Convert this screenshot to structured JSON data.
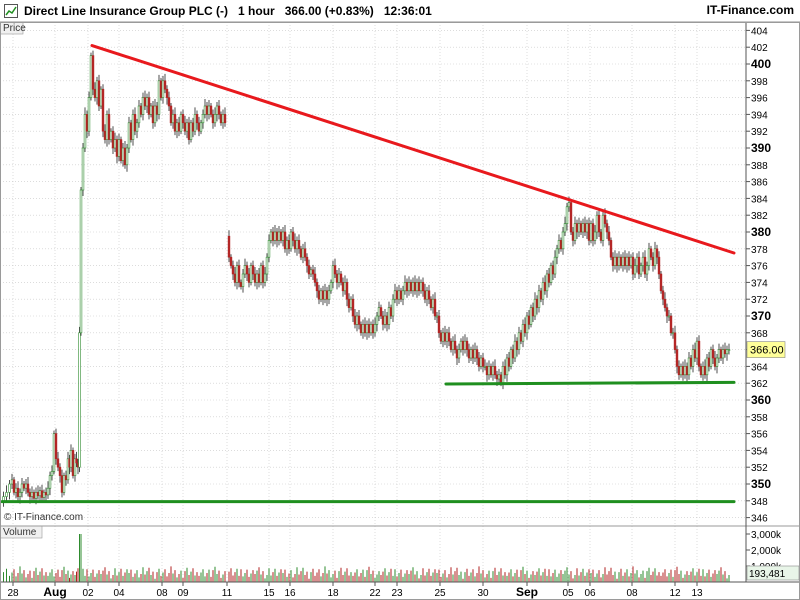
{
  "header": {
    "symbol": "Direct Line Insurance Group PLC (-)",
    "interval": "1 hour",
    "last": "366.00 (+0.83%)",
    "time": "12:36:01",
    "brand": "IT-Finance.com"
  },
  "panes": {
    "price_label": "Price",
    "volume_label": "Volume",
    "watermark": "© IT-Finance.com"
  },
  "colors": {
    "up": "#2e8b2e",
    "down": "#b22222",
    "resistance": "#e8191d",
    "support": "#1f8f1f",
    "grid": "#c8c8c8"
  },
  "chart_data": {
    "type": "candlestick",
    "title": "Direct Line Insurance Group PLC (-)",
    "interval": "1 hour",
    "y_ticks": [
      346,
      348,
      350,
      352,
      354,
      356,
      358,
      360,
      362,
      364,
      366,
      368,
      370,
      372,
      374,
      376,
      378,
      380,
      382,
      384,
      386,
      388,
      390,
      392,
      394,
      396,
      398,
      400,
      402,
      404
    ],
    "ylim": [
      345,
      405
    ],
    "last_price_label": "366.00",
    "x_ticks": [
      "28",
      "Aug",
      "02",
      "04",
      "08",
      "09",
      "11",
      "15",
      "16",
      "18",
      "22",
      "23",
      "25",
      "30",
      "Sep",
      "05",
      "06",
      "08",
      "12",
      "13"
    ],
    "price_path": [
      [
        0,
        348
      ],
      [
        3,
        348.5
      ],
      [
        6,
        349
      ],
      [
        9,
        350
      ],
      [
        11,
        350.5
      ],
      [
        13,
        349
      ],
      [
        15,
        349.5
      ],
      [
        17,
        348.5
      ],
      [
        19,
        349
      ],
      [
        21,
        350
      ],
      [
        23,
        349.5
      ],
      [
        25,
        350
      ],
      [
        27,
        349
      ],
      [
        29,
        348.5
      ],
      [
        31,
        349
      ],
      [
        33,
        348.3
      ],
      [
        35,
        349
      ],
      [
        37,
        348.6
      ],
      [
        39,
        349.2
      ],
      [
        41,
        348.4
      ],
      [
        43,
        349
      ],
      [
        45,
        348.7
      ],
      [
        47,
        349.5
      ],
      [
        49,
        351
      ],
      [
        51,
        351.5
      ],
      [
        53,
        356
      ],
      [
        55,
        353
      ],
      [
        57,
        352
      ],
      [
        59,
        351
      ],
      [
        61,
        349
      ],
      [
        63,
        351
      ],
      [
        65,
        350.5
      ],
      [
        67,
        353
      ],
      [
        68,
        352
      ],
      [
        70,
        354
      ],
      [
        72,
        351
      ],
      [
        74,
        353
      ],
      [
        75,
        352.5
      ],
      [
        77,
        352
      ],
      [
        78,
        368
      ],
      [
        80,
        385
      ],
      [
        82,
        390
      ],
      [
        84,
        394
      ],
      [
        86,
        392
      ],
      [
        88,
        396
      ],
      [
        90,
        401
      ],
      [
        92,
        397
      ],
      [
        94,
        396
      ],
      [
        96,
        398
      ],
      [
        98,
        395
      ],
      [
        100,
        397
      ],
      [
        102,
        392
      ],
      [
        104,
        391
      ],
      [
        106,
        394
      ],
      [
        108,
        391
      ],
      [
        110,
        392
      ],
      [
        112,
        390
      ],
      [
        114,
        391
      ],
      [
        116,
        389
      ],
      [
        118,
        391
      ],
      [
        120,
        388.5
      ],
      [
        122,
        390
      ],
      [
        124,
        388
      ],
      [
        126,
        390
      ],
      [
        128,
        393
      ],
      [
        130,
        391
      ],
      [
        132,
        394
      ],
      [
        134,
        392
      ],
      [
        136,
        393
      ],
      [
        138,
        395
      ],
      [
        140,
        394
      ],
      [
        142,
        396
      ],
      [
        144,
        395
      ],
      [
        146,
        396
      ],
      [
        148,
        394
      ],
      [
        150,
        395
      ],
      [
        152,
        393
      ],
      [
        154,
        395
      ],
      [
        156,
        394
      ],
      [
        158,
        398
      ],
      [
        160,
        396
      ],
      [
        162,
        398
      ],
      [
        164,
        397
      ],
      [
        166,
        396
      ],
      [
        168,
        395
      ],
      [
        170,
        393
      ],
      [
        172,
        394
      ],
      [
        174,
        392
      ],
      [
        176,
        393
      ],
      [
        178,
        392
      ],
      [
        180,
        394
      ],
      [
        182,
        393
      ],
      [
        184,
        392
      ],
      [
        186,
        393
      ],
      [
        188,
        391
      ],
      [
        190,
        393
      ],
      [
        192,
        392
      ],
      [
        194,
        394
      ],
      [
        196,
        393
      ],
      [
        198,
        392
      ],
      [
        200,
        393
      ],
      [
        202,
        394
      ],
      [
        204,
        395
      ],
      [
        206,
        394
      ],
      [
        208,
        395
      ],
      [
        210,
        394
      ],
      [
        212,
        393
      ],
      [
        214,
        394
      ],
      [
        216,
        395
      ],
      [
        218,
        394
      ],
      [
        220,
        393
      ],
      [
        222,
        394
      ],
      [
        224,
        393
      ],
      [
        226,
        379.5
      ],
      [
        228,
        377
      ],
      [
        230,
        376
      ],
      [
        232,
        375
      ],
      [
        234,
        374
      ],
      [
        236,
        376
      ],
      [
        238,
        374
      ],
      [
        240,
        373.5
      ],
      [
        242,
        375
      ],
      [
        244,
        376
      ],
      [
        246,
        375
      ],
      [
        248,
        374
      ],
      [
        250,
        376
      ],
      [
        252,
        375
      ],
      [
        254,
        374
      ],
      [
        256,
        375
      ],
      [
        258,
        374
      ],
      [
        260,
        376
      ],
      [
        262,
        374
      ],
      [
        264,
        375
      ],
      [
        266,
        377
      ],
      [
        268,
        379
      ],
      [
        270,
        380
      ],
      [
        272,
        379
      ],
      [
        274,
        380
      ],
      [
        276,
        379
      ],
      [
        278,
        380
      ],
      [
        280,
        379
      ],
      [
        282,
        380
      ],
      [
        284,
        378
      ],
      [
        286,
        379
      ],
      [
        288,
        378
      ],
      [
        290,
        380
      ],
      [
        292,
        379
      ],
      [
        294,
        378
      ],
      [
        296,
        379
      ],
      [
        298,
        378
      ],
      [
        300,
        377
      ],
      [
        302,
        378
      ],
      [
        304,
        377
      ],
      [
        306,
        376
      ],
      [
        308,
        375
      ],
      [
        310,
        375.5
      ],
      [
        312,
        375
      ],
      [
        314,
        374
      ],
      [
        316,
        373
      ],
      [
        318,
        372
      ],
      [
        320,
        373
      ],
      [
        322,
        372
      ],
      [
        324,
        373
      ],
      [
        326,
        372
      ],
      [
        328,
        373
      ],
      [
        330,
        374
      ],
      [
        332,
        376
      ],
      [
        334,
        375
      ],
      [
        336,
        374
      ],
      [
        338,
        375
      ],
      [
        340,
        374
      ],
      [
        342,
        373
      ],
      [
        344,
        374
      ],
      [
        346,
        372
      ],
      [
        348,
        371
      ],
      [
        350,
        372
      ],
      [
        352,
        370
      ],
      [
        354,
        369
      ],
      [
        356,
        370
      ],
      [
        358,
        369
      ],
      [
        360,
        368
      ],
      [
        362,
        369
      ],
      [
        364,
        368
      ],
      [
        366,
        369
      ],
      [
        368,
        368
      ],
      [
        370,
        369
      ],
      [
        372,
        368
      ],
      [
        374,
        369
      ],
      [
        376,
        370
      ],
      [
        378,
        371
      ],
      [
        380,
        370
      ],
      [
        382,
        369
      ],
      [
        384,
        370
      ],
      [
        386,
        369
      ],
      [
        388,
        371
      ],
      [
        390,
        370
      ],
      [
        392,
        372
      ],
      [
        394,
        373
      ],
      [
        396,
        372
      ],
      [
        398,
        373
      ],
      [
        400,
        372
      ],
      [
        402,
        373
      ],
      [
        404,
        374
      ],
      [
        406,
        373
      ],
      [
        408,
        374
      ],
      [
        410,
        373
      ],
      [
        412,
        374
      ],
      [
        414,
        373
      ],
      [
        416,
        374
      ],
      [
        418,
        373
      ],
      [
        420,
        374
      ],
      [
        422,
        373
      ],
      [
        424,
        372
      ],
      [
        426,
        373
      ],
      [
        428,
        372
      ],
      [
        430,
        371
      ],
      [
        432,
        372
      ],
      [
        434,
        370
      ],
      [
        436,
        370
      ],
      [
        438,
        368
      ],
      [
        440,
        367
      ],
      [
        442,
        368
      ],
      [
        444,
        367
      ],
      [
        446,
        368
      ],
      [
        448,
        367
      ],
      [
        450,
        366
      ],
      [
        452,
        367
      ],
      [
        454,
        366
      ],
      [
        456,
        365
      ],
      [
        458,
        366
      ],
      [
        460,
        367
      ],
      [
        462,
        366
      ],
      [
        464,
        367
      ],
      [
        466,
        366
      ],
      [
        468,
        365
      ],
      [
        470,
        366
      ],
      [
        472,
        365
      ],
      [
        474,
        366
      ],
      [
        476,
        365
      ],
      [
        478,
        364
      ],
      [
        480,
        365
      ],
      [
        482,
        364
      ],
      [
        484,
        364
      ],
      [
        486,
        363
      ],
      [
        488,
        364
      ],
      [
        490,
        363
      ],
      [
        492,
        364
      ],
      [
        494,
        363
      ],
      [
        496,
        362.5
      ],
      [
        498,
        363
      ],
      [
        500,
        362
      ],
      [
        502,
        364
      ],
      [
        504,
        363
      ],
      [
        506,
        365
      ],
      [
        508,
        364
      ],
      [
        510,
        366
      ],
      [
        512,
        365
      ],
      [
        514,
        367
      ],
      [
        516,
        366
      ],
      [
        518,
        368
      ],
      [
        520,
        367
      ],
      [
        522,
        369
      ],
      [
        524,
        368
      ],
      [
        526,
        370
      ],
      [
        528,
        369
      ],
      [
        530,
        371
      ],
      [
        532,
        370
      ],
      [
        534,
        372
      ],
      [
        536,
        371
      ],
      [
        538,
        373
      ],
      [
        540,
        372
      ],
      [
        542,
        374
      ],
      [
        544,
        373
      ],
      [
        546,
        375
      ],
      [
        548,
        374
      ],
      [
        550,
        376
      ],
      [
        552,
        375
      ],
      [
        554,
        377
      ],
      [
        556,
        378
      ],
      [
        558,
        379
      ],
      [
        560,
        378
      ],
      [
        562,
        380
      ],
      [
        564,
        381
      ],
      [
        566,
        383
      ],
      [
        568,
        383.5
      ],
      [
        570,
        380
      ],
      [
        572,
        379
      ],
      [
        574,
        381
      ],
      [
        576,
        380
      ],
      [
        578,
        381
      ],
      [
        580,
        380
      ],
      [
        582,
        381
      ],
      [
        584,
        380
      ],
      [
        586,
        381
      ],
      [
        588,
        379
      ],
      [
        590,
        381
      ],
      [
        592,
        379
      ],
      [
        594,
        380
      ],
      [
        596,
        382
      ],
      [
        598,
        380
      ],
      [
        600,
        379
      ],
      [
        602,
        382
      ],
      [
        604,
        381
      ],
      [
        606,
        380
      ],
      [
        608,
        379
      ],
      [
        610,
        377
      ],
      [
        612,
        376
      ],
      [
        614,
        377
      ],
      [
        616,
        376
      ],
      [
        618,
        377
      ],
      [
        620,
        376
      ],
      [
        622,
        377
      ],
      [
        624,
        376
      ],
      [
        626,
        377
      ],
      [
        628,
        376
      ],
      [
        630,
        377
      ],
      [
        632,
        375
      ],
      [
        634,
        376
      ],
      [
        636,
        377
      ],
      [
        638,
        375
      ],
      [
        640,
        376
      ],
      [
        642,
        377
      ],
      [
        644,
        375
      ],
      [
        646,
        376
      ],
      [
        648,
        378
      ],
      [
        650,
        377
      ],
      [
        652,
        376
      ],
      [
        654,
        378
      ],
      [
        656,
        377
      ],
      [
        658,
        375
      ],
      [
        660,
        373
      ],
      [
        662,
        372
      ],
      [
        664,
        371
      ],
      [
        666,
        370
      ],
      [
        668,
        370
      ],
      [
        670,
        368
      ],
      [
        672,
        368
      ],
      [
        674,
        366
      ],
      [
        676,
        364
      ],
      [
        678,
        363
      ],
      [
        680,
        364
      ],
      [
        682,
        363
      ],
      [
        684,
        364
      ],
      [
        686,
        363
      ],
      [
        688,
        365
      ],
      [
        690,
        364
      ],
      [
        692,
        366
      ],
      [
        694,
        365
      ],
      [
        696,
        367
      ],
      [
        698,
        364
      ],
      [
        700,
        363
      ],
      [
        702,
        364
      ],
      [
        704,
        363
      ],
      [
        706,
        365
      ],
      [
        708,
        364
      ],
      [
        710,
        366
      ],
      [
        712,
        365
      ],
      [
        714,
        364
      ],
      [
        716,
        365
      ],
      [
        718,
        366
      ],
      [
        720,
        365
      ],
      [
        722,
        366
      ],
      [
        724,
        365.5
      ],
      [
        726,
        366
      ],
      [
        728,
        366
      ]
    ],
    "gaps_after_x": [
      224
    ],
    "volume": {
      "ylim": [
        0,
        3500
      ],
      "y_ticks": [
        "3,000k",
        "2,000k",
        "1,000k"
      ],
      "last_label": "193,481"
    },
    "trendlines": [
      {
        "kind": "resistance",
        "from": [
          90,
          402.2
        ],
        "to": [
          732,
          377.5
        ]
      },
      {
        "kind": "support",
        "from": [
          444,
          361.9
        ],
        "to": [
          732,
          362.1
        ]
      },
      {
        "kind": "support",
        "from": [
          0,
          347.9
        ],
        "to": [
          732,
          347.9
        ]
      }
    ]
  }
}
